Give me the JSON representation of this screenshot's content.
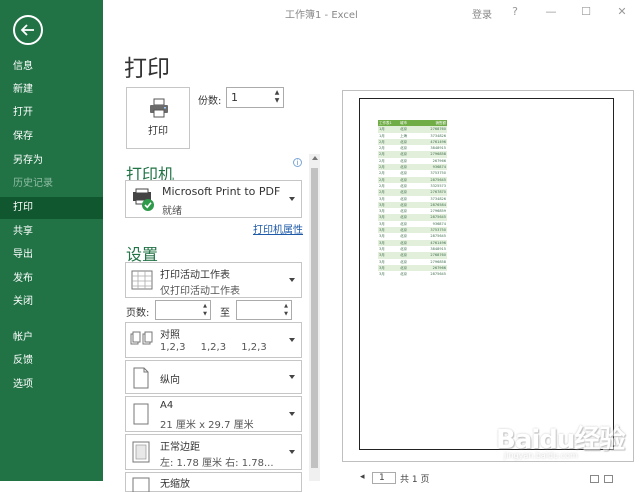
{
  "titlebar": {
    "title": "工作簿1  -  Excel",
    "login": "登录",
    "help": "?",
    "minimize": "—",
    "maximize": "☐",
    "close": "✕"
  },
  "sidebar": {
    "items": [
      {
        "label": "信息"
      },
      {
        "label": "新建"
      },
      {
        "label": "打开"
      },
      {
        "label": "保存"
      },
      {
        "label": "另存为"
      },
      {
        "label": "历史记录"
      },
      {
        "label": "打印"
      },
      {
        "label": "共享"
      },
      {
        "label": "导出"
      },
      {
        "label": "发布"
      },
      {
        "label": "关闭"
      },
      {
        "label": "帐户"
      },
      {
        "label": "反馈"
      },
      {
        "label": "选项"
      }
    ],
    "active": "打印",
    "disabled": "历史记录"
  },
  "print": {
    "heading": "打印",
    "button_label": "打印",
    "copies_label": "份数:",
    "copies_value": "1"
  },
  "printer": {
    "heading": "打印机",
    "name": "Microsoft Print to PDF",
    "status": "就绪",
    "properties_link": "打印机属性",
    "info": "i"
  },
  "settings": {
    "heading": "设置",
    "scope_main": "打印活动工作表",
    "scope_sub": "仅打印活动工作表",
    "pages_label": "页数:",
    "pages_to_label": "至",
    "collate_main": "对照",
    "collate_sub": "1,2,3    1,2,3    1,2,3",
    "orientation": "纵向",
    "paper_main": "A4",
    "paper_sub": "21 厘米 x 29.7 厘米",
    "margin_main": "正常边距",
    "margin_sub": "左: 1.78 厘米    右: 1.78...",
    "scaling": "无缩放"
  },
  "preview": {
    "page_number": "1",
    "page_of": "共 1 页",
    "table_header": [
      "工作表1",
      "城市",
      "销售额"
    ],
    "table_rows": [
      [
        "1月",
        "北京",
        "2768760"
      ],
      [
        "1月",
        "上海",
        "3734826"
      ],
      [
        "2月",
        "北京",
        "4761496"
      ],
      [
        "2月",
        "北京",
        "3848915"
      ],
      [
        "2月",
        "北京",
        "2796858"
      ],
      [
        "2月",
        "北京",
        "267966"
      ],
      [
        "2月",
        "北京",
        "936874"
      ],
      [
        "2月",
        "北京",
        "3753750"
      ],
      [
        "2月",
        "北京",
        "2875645"
      ],
      [
        "2月",
        "北京",
        "3325573"
      ],
      [
        "2月",
        "北京",
        "2767870"
      ],
      [
        "3月",
        "北京",
        "3734826"
      ],
      [
        "3月",
        "北京",
        "2876584"
      ],
      [
        "3月",
        "北京",
        "2796859"
      ],
      [
        "3月",
        "北京",
        "2875645"
      ],
      [
        "3月",
        "北京",
        "936874"
      ],
      [
        "3月",
        "北京",
        "3753750"
      ],
      [
        "3月",
        "北京",
        "2875645"
      ],
      [
        "3月",
        "北京",
        "4761496"
      ],
      [
        "3月",
        "北京",
        "3848915"
      ],
      [
        "3月",
        "北京",
        "2768760"
      ],
      [
        "3月",
        "北京",
        "2796858"
      ],
      [
        "3月",
        "北京",
        "267966"
      ],
      [
        "3月",
        "北京",
        "2875645"
      ]
    ]
  },
  "watermark": {
    "brand": "Baidu经验",
    "url": "jingyan.baidu.com"
  },
  "colors": {
    "excel_green": "#217346",
    "active_green": "#10572f",
    "table_header": "#70ad47",
    "table_band": "#e2efda"
  }
}
